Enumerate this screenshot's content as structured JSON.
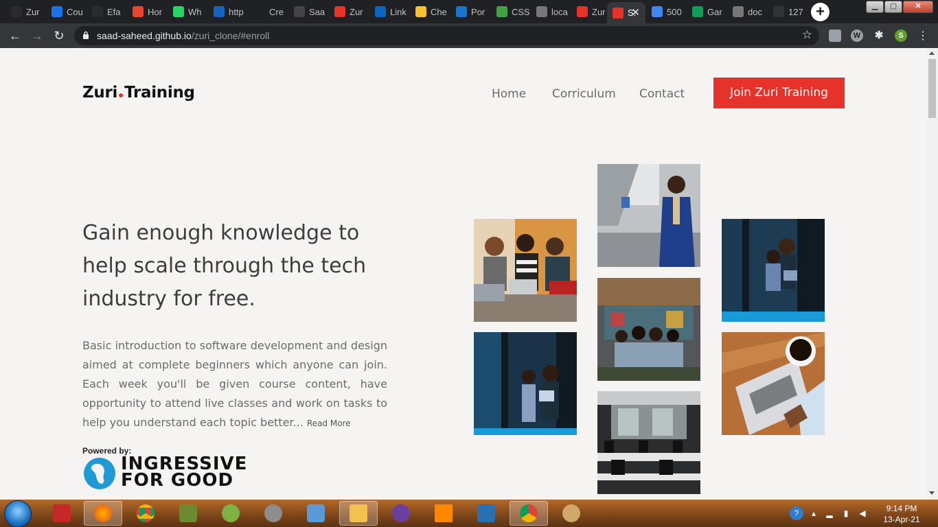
{
  "browser": {
    "tabs": [
      {
        "label": "Zur",
        "icon": "globe-icon",
        "color": "#2b2b2b"
      },
      {
        "label": "Cou",
        "icon": "coursera-icon",
        "color": "#1a73e8"
      },
      {
        "label": "Efa",
        "icon": "globe-icon",
        "color": "#2b2b2b"
      },
      {
        "label": "Hor",
        "icon": "app-icon",
        "color": "#e8472b"
      },
      {
        "label": "Wh",
        "icon": "whatsapp-icon",
        "color": "#25d366"
      },
      {
        "label": "http",
        "icon": "video-icon",
        "color": "#1565c0"
      },
      {
        "label": "Cre",
        "icon": "blank-icon",
        "color": "#202124"
      },
      {
        "label": "Saa",
        "icon": "github-icon",
        "color": "#444"
      },
      {
        "label": "Zur",
        "icon": "zuri-dot-icon",
        "color": "#e5332a"
      },
      {
        "label": "Link",
        "icon": "linkedin-icon",
        "color": "#0a66c2"
      },
      {
        "label": "Che",
        "icon": "gift-icon",
        "color": "#fbc02d"
      },
      {
        "label": "Por",
        "icon": "stackshare-icon",
        "color": "#1976d2"
      },
      {
        "label": "CSS",
        "icon": "chart-icon",
        "color": "#43a047"
      },
      {
        "label": "loca",
        "icon": "ext-icon",
        "color": "#777"
      },
      {
        "label": "Zur",
        "icon": "zuri-dot-icon",
        "color": "#e5332a"
      },
      {
        "label": "S.",
        "icon": "saad-icon",
        "color": "#e5332a"
      },
      {
        "label": "500",
        "icon": "docs-icon",
        "color": "#4285f4"
      },
      {
        "label": "Gar",
        "icon": "sheets-icon",
        "color": "#0f9d58"
      },
      {
        "label": "doc",
        "icon": "doc-icon",
        "color": "#777"
      },
      {
        "label": "127",
        "icon": "saad-icon",
        "color": "#333"
      }
    ],
    "active_tab_index": 15,
    "url_host": "saad-saheed.github.io",
    "url_path": "/zuri_clone/#enroll",
    "profile_initial": "S",
    "ext_w": "W"
  },
  "page": {
    "logo_left": "Zuri",
    "logo_right": "Training",
    "nav": [
      "Home",
      "Corriculum",
      "Contact"
    ],
    "cta_label": "Join Zuri Training",
    "hero_title": "Gain enough knowledge to help scale through the tech industry for free.",
    "hero_body": "Basic introduction to software development and design aimed at complete beginners which anyone can join. Each week you'll be given course content, have opportunity to attend live classes and work on tasks to help you understand each topic better...",
    "read_more": "Read More",
    "powered_by": "Powered by:",
    "partner_line1": "INGRESSIVE",
    "partner_line2": "FOR GOOD",
    "accent": "#e5332a",
    "photos": [
      "women-with-laptops-photo",
      "man-in-blue-suit-photo",
      "couple-at-window-photo",
      "women-group-mural-photo",
      "couple-at-window-photo-2",
      "coffee-newspaper-photo",
      "office-room-photo"
    ]
  },
  "taskbar": {
    "time": "9:14 PM",
    "date": "13-Apr-21"
  }
}
